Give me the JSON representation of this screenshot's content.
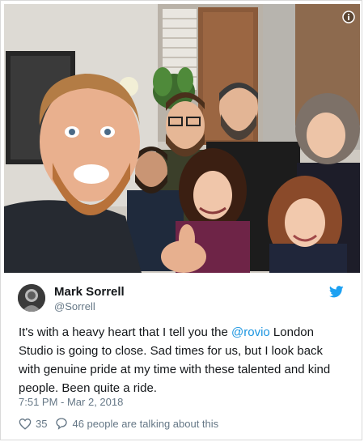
{
  "tweet": {
    "author_name": "Mark Sorrell",
    "author_handle": "@Sorrell",
    "text_before": "It's with a heavy heart that I tell you the ",
    "mention": "@rovio",
    "text_after": " London Studio is going to close. Sad times for us, but I look back with genuine pride at my time with these talented and kind people. Been quite a ride.",
    "timestamp": "7:51 PM - Mar 2, 2018",
    "like_count": "35",
    "talking_text": "46 people are talking about this"
  },
  "icons": {
    "info": "info-icon",
    "brand": "twitter-bird-icon",
    "like": "heart-icon",
    "reply": "speech-bubble-icon"
  },
  "colors": {
    "brand": "#1da1f2",
    "mention": "#1b95e0",
    "secondary_text": "#657786",
    "primary_text": "#14171a"
  }
}
